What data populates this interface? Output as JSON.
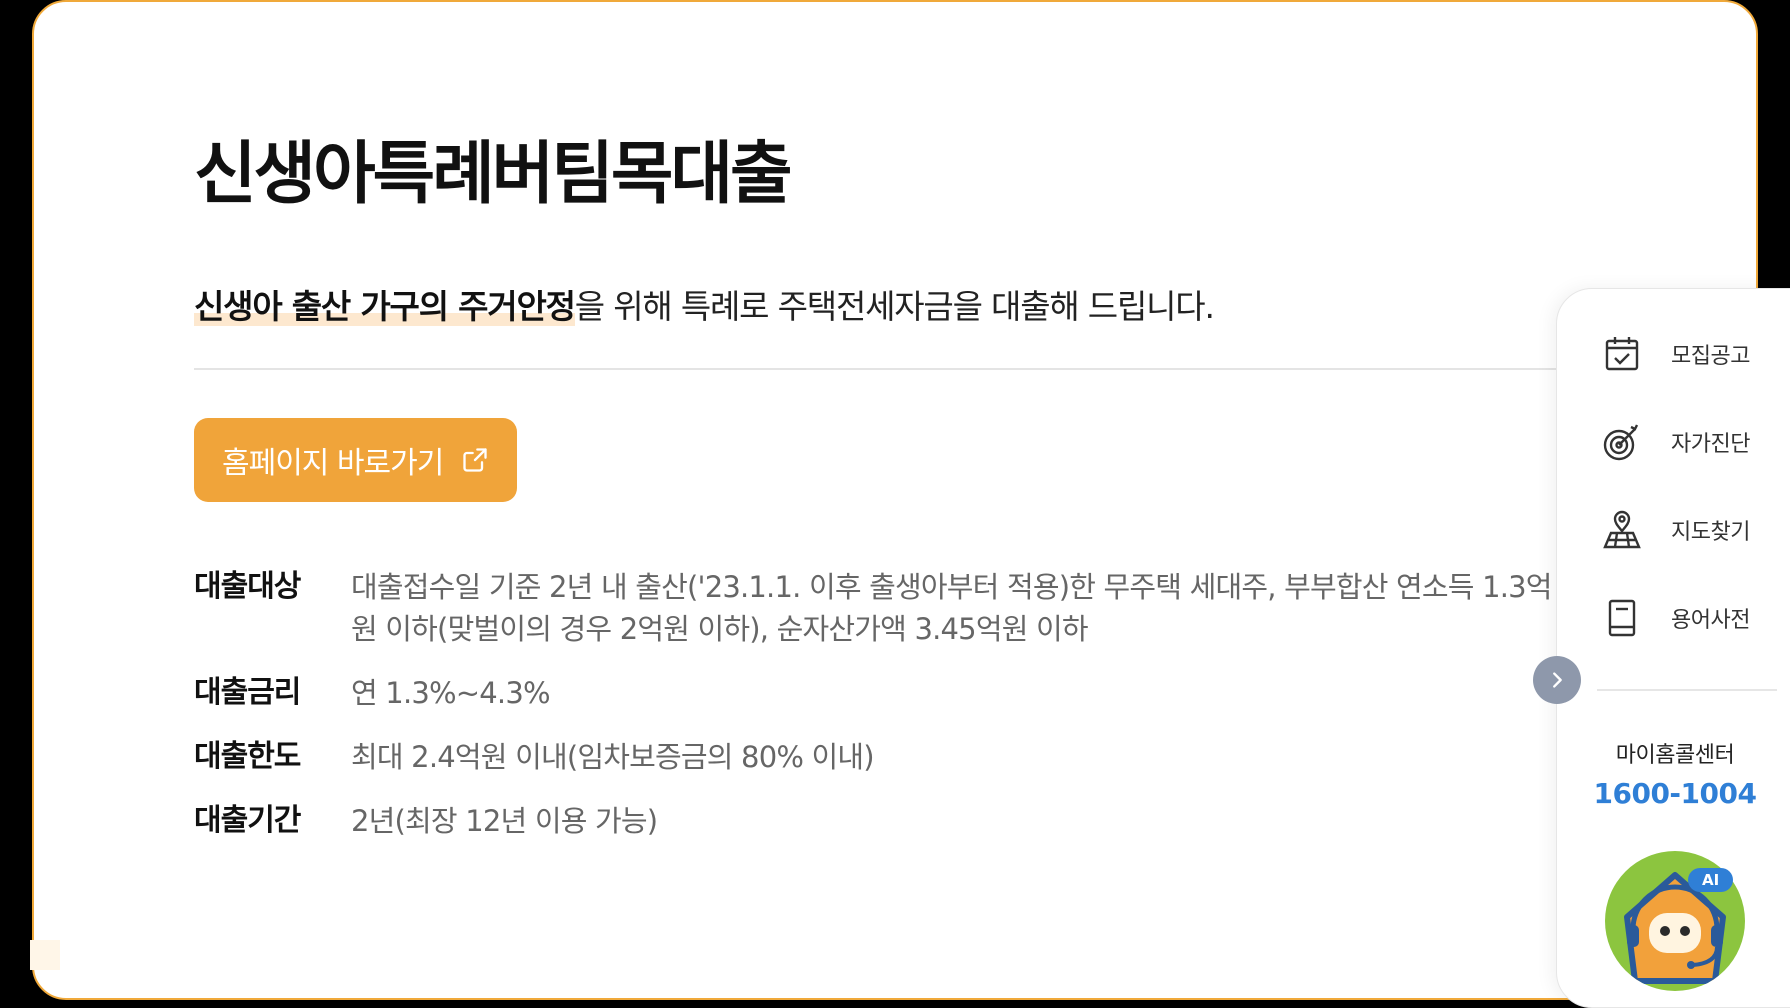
{
  "page": {
    "title": "신생아특례버팀목대출",
    "subtitle_highlight": "신생아 출산 가구의 주거안정",
    "subtitle_rest": "을 위해 특례로 주택전세자금을 대출해 드립니다.",
    "homepage_button": "홈페이지 바로가기"
  },
  "info": [
    {
      "label": "대출대상",
      "value": "대출접수일 기준 2년 내 출산('23.1.1. 이후 출생아부터 적용)한 무주택 세대주, 부부합산 연소득 1.3억원 이하(맞벌이의 경우 2억원 이하), 순자산가액 3.45억원 이하"
    },
    {
      "label": "대출금리",
      "value": "연 1.3%~4.3%"
    },
    {
      "label": "대출한도",
      "value": "최대 2.4억원 이내(임차보증금의 80% 이내)"
    },
    {
      "label": "대출기간",
      "value": "2년(최장 12년 이용 가능)"
    }
  ],
  "quick_menu": {
    "items": [
      {
        "label": "모집공고",
        "icon": "calendar-check-icon"
      },
      {
        "label": "자가진단",
        "icon": "target-icon"
      },
      {
        "label": "지도찾기",
        "icon": "map-pin-icon"
      },
      {
        "label": "용어사전",
        "icon": "book-icon"
      }
    ],
    "call_center_name": "마이홈콜센터",
    "call_center_number": "1600-1004",
    "ai_badge": "AI"
  },
  "colors": {
    "accent": "#f0a43a",
    "border": "#f0a93a",
    "link_blue": "#2f7fd6",
    "bot_green": "#8cc53f"
  }
}
